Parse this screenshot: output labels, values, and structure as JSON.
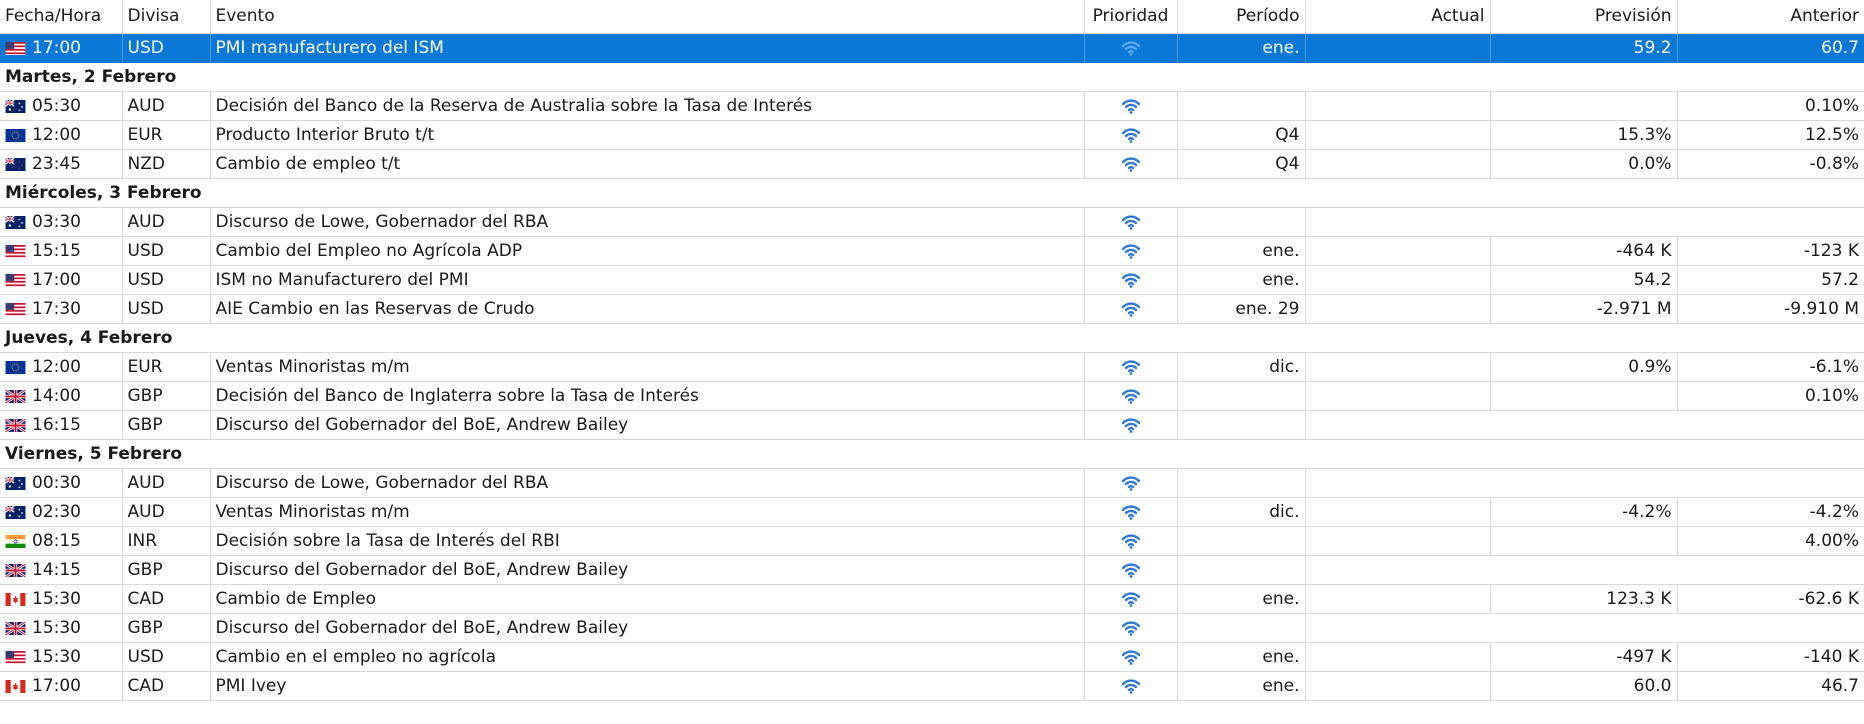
{
  "colors": {
    "selection": "#0a78d7",
    "priority_icon": "#2f78d6",
    "grid": "#d9d9d9"
  },
  "columns": [
    "Fecha/Hora",
    "Divisa",
    "Evento",
    "Prioridad",
    "Período",
    "Actual",
    "Previsión",
    "Anterior"
  ],
  "rows": [
    {
      "type": "event",
      "selected": true,
      "flag": "us",
      "time": "17:00",
      "currency": "USD",
      "event": "PMI manufacturero del ISM",
      "period": "ene.",
      "actual": "",
      "forecast": "59.2",
      "previous": "60.7",
      "icon": "signal-priority-icon"
    },
    {
      "type": "day",
      "label": "Martes, 2 Febrero"
    },
    {
      "type": "event",
      "flag": "au",
      "time": "05:30",
      "currency": "AUD",
      "event": "Decisión del Banco de la Reserva de Australia sobre la Tasa de Interés",
      "period": "",
      "actual": "",
      "forecast": "",
      "previous": "0.10%",
      "icon": "signal-priority-icon"
    },
    {
      "type": "event",
      "flag": "eu",
      "time": "12:00",
      "currency": "EUR",
      "event": "Producto Interior Bruto t/t",
      "period": "Q4",
      "actual": "",
      "forecast": "15.3%",
      "previous": "12.5%",
      "icon": "signal-priority-icon"
    },
    {
      "type": "event",
      "flag": "nz",
      "time": "23:45",
      "currency": "NZD",
      "event": "Cambio de empleo t/t",
      "period": "Q4",
      "actual": "",
      "forecast": "0.0%",
      "previous": "-0.8%",
      "icon": "signal-priority-icon"
    },
    {
      "type": "day",
      "label": "Miércoles, 3 Febrero"
    },
    {
      "type": "event",
      "flag": "au",
      "time": "03:30",
      "currency": "AUD",
      "event": "Discurso de Lowe, Gobernador del RBA",
      "period": "",
      "actual": "",
      "forecast": "",
      "previous": "",
      "icon": "signal-priority-icon",
      "span": true
    },
    {
      "type": "event",
      "flag": "us",
      "time": "15:15",
      "currency": "USD",
      "event": "Cambio del Empleo no Agrícola ADP",
      "period": "ene.",
      "actual": "",
      "forecast": "-464 K",
      "previous": "-123 K",
      "icon": "signal-priority-icon"
    },
    {
      "type": "event",
      "flag": "us",
      "time": "17:00",
      "currency": "USD",
      "event": "ISM no Manufacturero del PMI",
      "period": "ene.",
      "actual": "",
      "forecast": "54.2",
      "previous": "57.2",
      "icon": "signal-priority-icon"
    },
    {
      "type": "event",
      "flag": "us",
      "time": "17:30",
      "currency": "USD",
      "event": "AIE Cambio en las Reservas de Crudo",
      "period": "ene. 29",
      "actual": "",
      "forecast": "-2.971 M",
      "previous": "-9.910 M",
      "icon": "signal-priority-icon"
    },
    {
      "type": "day",
      "label": "Jueves, 4 Febrero"
    },
    {
      "type": "event",
      "flag": "eu",
      "time": "12:00",
      "currency": "EUR",
      "event": "Ventas Minoristas m/m",
      "period": "dic.",
      "actual": "",
      "forecast": "0.9%",
      "previous": "-6.1%",
      "icon": "signal-priority-icon"
    },
    {
      "type": "event",
      "flag": "gb",
      "time": "14:00",
      "currency": "GBP",
      "event": "Decisión del Banco de Inglaterra sobre la Tasa de Interés",
      "period": "",
      "actual": "",
      "forecast": "",
      "previous": "0.10%",
      "icon": "signal-priority-icon"
    },
    {
      "type": "event",
      "flag": "gb",
      "time": "16:15",
      "currency": "GBP",
      "event": "Discurso del Gobernador del BoE, Andrew Bailey",
      "period": "",
      "actual": "",
      "forecast": "",
      "previous": "",
      "icon": "signal-priority-icon",
      "span": true
    },
    {
      "type": "day",
      "label": "Viernes, 5 Febrero"
    },
    {
      "type": "event",
      "flag": "au",
      "time": "00:30",
      "currency": "AUD",
      "event": "Discurso de Lowe, Gobernador del RBA",
      "period": "",
      "actual": "",
      "forecast": "",
      "previous": "",
      "icon": "signal-priority-icon",
      "span": true
    },
    {
      "type": "event",
      "flag": "au",
      "time": "02:30",
      "currency": "AUD",
      "event": "Ventas Minoristas m/m",
      "period": "dic.",
      "actual": "",
      "forecast": "-4.2%",
      "previous": "-4.2%",
      "icon": "signal-priority-icon"
    },
    {
      "type": "event",
      "flag": "in",
      "time": "08:15",
      "currency": "INR",
      "event": "Decisión sobre la Tasa de Interés del RBI",
      "period": "",
      "actual": "",
      "forecast": "",
      "previous": "4.00%",
      "icon": "signal-priority-icon"
    },
    {
      "type": "event",
      "flag": "gb",
      "time": "14:15",
      "currency": "GBP",
      "event": "Discurso del Gobernador del BoE, Andrew Bailey",
      "period": "",
      "actual": "",
      "forecast": "",
      "previous": "",
      "icon": "signal-priority-icon",
      "span": true
    },
    {
      "type": "event",
      "flag": "ca",
      "time": "15:30",
      "currency": "CAD",
      "event": "Cambio de Empleo",
      "period": "ene.",
      "actual": "",
      "forecast": "123.3 K",
      "previous": "-62.6 K",
      "icon": "signal-priority-icon"
    },
    {
      "type": "event",
      "flag": "gb",
      "time": "15:30",
      "currency": "GBP",
      "event": "Discurso del Gobernador del BoE, Andrew Bailey",
      "period": "",
      "actual": "",
      "forecast": "",
      "previous": "",
      "icon": "signal-priority-icon",
      "span": true
    },
    {
      "type": "event",
      "flag": "us",
      "time": "15:30",
      "currency": "USD",
      "event": "Cambio en el empleo no agrícola",
      "period": "ene.",
      "actual": "",
      "forecast": "-497 K",
      "previous": "-140 K",
      "icon": "signal-priority-icon"
    },
    {
      "type": "event",
      "flag": "ca",
      "time": "17:00",
      "currency": "CAD",
      "event": "PMI Ivey",
      "period": "ene.",
      "actual": "",
      "forecast": "60.0",
      "previous": "46.7",
      "icon": "signal-priority-icon"
    }
  ]
}
